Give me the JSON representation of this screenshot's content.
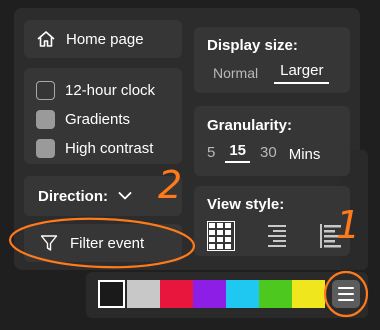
{
  "home": {
    "label": "Home page",
    "icon": "home-icon"
  },
  "options": [
    {
      "label": "12-hour clock",
      "checked": false
    },
    {
      "label": "Gradients",
      "checked": true
    },
    {
      "label": "High contrast",
      "checked": true
    }
  ],
  "direction": {
    "label": "Direction:",
    "icon": "chevron-down-icon"
  },
  "filter": {
    "label": "Filter event",
    "icon": "filter-icon"
  },
  "display_size": {
    "title": "Display size:",
    "options": [
      "Normal",
      "Larger"
    ],
    "selected": "Larger"
  },
  "granularity": {
    "title": "Granularity:",
    "options": [
      "5",
      "15",
      "30"
    ],
    "selected": "15",
    "unit": "Mins"
  },
  "view_style": {
    "title": "View style:",
    "options": [
      "grid-view-icon",
      "compact-list-icon",
      "detailed-list-icon"
    ],
    "selected": "grid-view-icon"
  },
  "palette": {
    "colors": [
      "#1a1a1a",
      "#c8c8c8",
      "#e8163c",
      "#8c1ee6",
      "#1ec8f0",
      "#4cc81e",
      "#f0e61e"
    ],
    "selected": "#1a1a1a"
  },
  "menu_button": {
    "icon": "hamburger-menu-icon"
  },
  "annotations": {
    "label_1": "1",
    "label_2": "2",
    "color": "#ff7a1a"
  }
}
